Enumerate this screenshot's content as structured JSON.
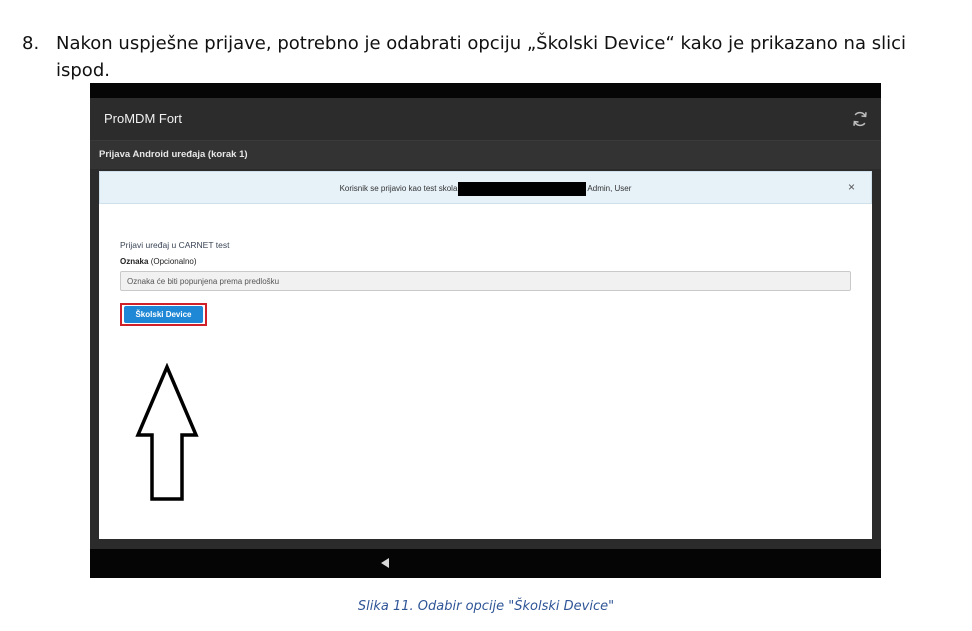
{
  "instruction": {
    "number": "8.",
    "text": "Nakon uspješne prijave, potrebno je odabrati opciju „Školski Device“ kako je prikazano na slici ispod."
  },
  "app": {
    "title": "ProMDM Fort",
    "subheader": "Prijava Android uređaja (korak 1)",
    "alert": {
      "text_before": "Korisnik se prijavio kao test skola",
      "text_after": "Admin, User",
      "close": "×"
    },
    "form": {
      "heading": "Prijavi uređaj u CARNET test",
      "label": "Oznaka",
      "label_suffix": "(Opcionalno)",
      "placeholder": "Oznaka će biti popunjena prema predlošku",
      "button_label": "Školski Device"
    },
    "icons": {
      "refresh": "refresh-icon",
      "back": "back-triangle-icon",
      "arrow": "up-arrow-icon"
    }
  },
  "caption": "Slika 11. Odabir opcije \"Školski Device\"",
  "colors": {
    "accent_button": "#1e88d6",
    "highlight": "#d0202a",
    "caption": "#2f5597",
    "app_bar": "#2c2c2c"
  }
}
